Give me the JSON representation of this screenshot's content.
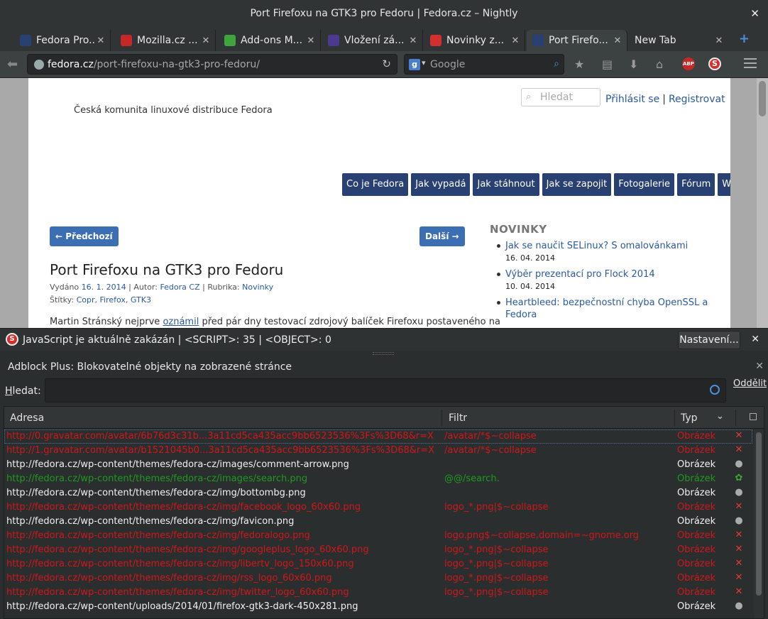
{
  "window": {
    "title": "Port Firefoxu na GTK3 pro Fedoru | Fedora.cz – Nightly",
    "close": "✕"
  },
  "tabs": [
    {
      "label": "Fedora Pro...",
      "close": "✕",
      "icon_color": "#294172",
      "icon": "fedora-icon"
    },
    {
      "label": "Mozilla.cz ...",
      "close": "✕",
      "icon_color": "#c62828",
      "icon": "mozilla-dino-icon"
    },
    {
      "label": "Add-ons M...",
      "close": "✕",
      "icon_color": "#3ea53e",
      "icon": "puzzle-icon"
    },
    {
      "label": "Vložení zá...",
      "close": "✕",
      "icon_color": "#4b3a8f",
      "icon": "editor-icon"
    },
    {
      "label": "Novinky z...",
      "close": "✕",
      "icon_color": "#d32f2f",
      "icon": "novinky-icon"
    },
    {
      "label": "Port Firefo...",
      "close": "✕",
      "icon_color": "#294172",
      "icon": "fedora-icon"
    },
    {
      "label": "New Tab",
      "close": "✕",
      "icon_color": "transparent",
      "icon": "none"
    }
  ],
  "newtab": "+",
  "nav": {
    "url_host": "fedora.cz",
    "url_path": "/port-firefoxu-na-gtk3-pro-fedoru/",
    "search_placeholder": "Google",
    "search_engine_letter": "g"
  },
  "site": {
    "search_placeholder": "Hledat",
    "login": "Přihlásit se",
    "login_sep": "|",
    "register": "Registrovat",
    "tagline": "Česká komunita linuxové distribuce Fedora",
    "menu": [
      "Co je Fedora",
      "Jak vypadá",
      "Jak stáhnout",
      "Jak se zapojit",
      "Fotogalerie",
      "Fórum",
      "Wiki"
    ],
    "prev": "← Předchozí",
    "next": "Další →",
    "post_title": "Port Firefoxu na GTK3 pro Fedoru",
    "meta_published": "Vydáno ",
    "meta_date": "16. 1. 2014",
    "meta_author_label": " | Autor: ",
    "meta_author": "Fedora CZ",
    "meta_category_label": " | Rubrika: ",
    "meta_category": "Novinky",
    "tags_label": "Štítky: ",
    "tags": [
      "Copr",
      "Firefox",
      "GTK3"
    ],
    "body_pre": "Martin Stránský nejprve ",
    "body_link": "oznámil",
    "body_post": " před pár dny testovací zdrojový balíček Firefoxu postaveného na",
    "news_heading": "NOVINKY",
    "news": [
      {
        "title": "Jak se naučit SELinux? S omalovánkami",
        "date": "16. 04. 2014"
      },
      {
        "title": "Výběr prezentací pro Flock 2014",
        "date": "10. 04. 2014"
      },
      {
        "title": "Heartbleed: bezpečnostní chyba OpenSSL a Fedora",
        "date": ""
      }
    ]
  },
  "noscript": {
    "message": "JavaScript je aktuálně zakázán | <SCRIPT>: 35 | <OBJECT>: 0",
    "settings": "Nastavení...",
    "close": "✕"
  },
  "abp": {
    "title": "Adblock Plus: Blokovatelné objekty na zobrazené stránce",
    "close": "✕",
    "search_label_accel": "H",
    "search_label_rest": "ledat:",
    "search_value": "",
    "detach": "Oddělit",
    "columns": {
      "address": "Adresa",
      "filter": "Filtr",
      "type": "Typ"
    },
    "rows": [
      {
        "address": "http://0.gravatar.com/avatar/6b76d3c31b...3a11cd5ca435acc9bb6523536%3Fs%3D68&r=X",
        "filter": "/avatar/*$~collapse",
        "type": "Obrázek",
        "status": "blocked"
      },
      {
        "address": "http://1.gravatar.com/avatar/b1521045b0...3a11cd5ca435acc9bb6523536%3Fs%3D68&r=X",
        "filter": "/avatar/*$~collapse",
        "type": "Obrázek",
        "status": "blocked"
      },
      {
        "address": "http://fedora.cz/wp-content/themes/fedora-cz/images/comment-arrow.png",
        "filter": "",
        "type": "Obrázek",
        "status": "neutral"
      },
      {
        "address": "http://fedora.cz/wp-content/themes/fedora-cz/images/search.png",
        "filter": "@@/search.",
        "type": "Obrázek",
        "status": "whitelisted"
      },
      {
        "address": "http://fedora.cz/wp-content/themes/fedora-cz/img/bottombg.png",
        "filter": "",
        "type": "Obrázek",
        "status": "neutral"
      },
      {
        "address": "http://fedora.cz/wp-content/themes/fedora-cz/img/facebook_logo_60x60.png",
        "filter": "logo_*.png|$~collapse",
        "type": "Obrázek",
        "status": "blocked"
      },
      {
        "address": "http://fedora.cz/wp-content/themes/fedora-cz/img/favicon.png",
        "filter": "",
        "type": "Obrázek",
        "status": "neutral"
      },
      {
        "address": "http://fedora.cz/wp-content/themes/fedora-cz/img/fedoralogo.png",
        "filter": "logo.png$~collapse,domain=~gnome.org",
        "type": "Obrázek",
        "status": "blocked"
      },
      {
        "address": "http://fedora.cz/wp-content/themes/fedora-cz/img/googleplus_logo_60x60.png",
        "filter": "logo_*.png|$~collapse",
        "type": "Obrázek",
        "status": "blocked"
      },
      {
        "address": "http://fedora.cz/wp-content/themes/fedora-cz/img/libertv_logo_150x60.png",
        "filter": "logo_*.png|$~collapse",
        "type": "Obrázek",
        "status": "blocked"
      },
      {
        "address": "http://fedora.cz/wp-content/themes/fedora-cz/img/rss_logo_60x60.png",
        "filter": "logo_*.png|$~collapse",
        "type": "Obrázek",
        "status": "blocked"
      },
      {
        "address": "http://fedora.cz/wp-content/themes/fedora-cz/img/twitter_logo_60x60.png",
        "filter": "logo_*.png|$~collapse",
        "type": "Obrázek",
        "status": "blocked"
      },
      {
        "address": "http://fedora.cz/wp-content/uploads/2014/01/firefox-gtk3-dark-450x281.png",
        "filter": "",
        "type": "Obrázek",
        "status": "neutral"
      }
    ]
  }
}
